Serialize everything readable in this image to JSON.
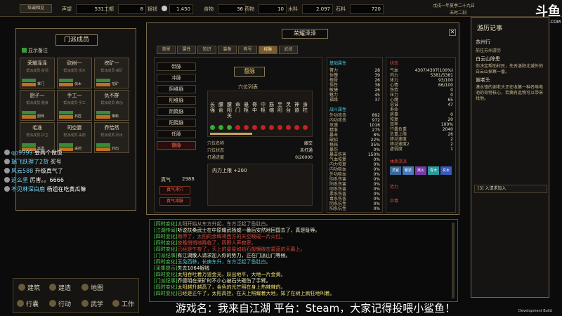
{
  "topbar": {
    "left_btn": "培诚相见",
    "prestige_label": "声望",
    "prestige": "531",
    "work_label": "工都",
    "work": "8",
    "resources": [
      {
        "label": "银钱",
        "value": "1.450"
      },
      {
        "label": "食物",
        "value": "36"
      },
      {
        "label": "药物",
        "value": "10"
      },
      {
        "label": "木料",
        "value": "2.097"
      },
      {
        "label": "石料",
        "value": "720"
      }
    ],
    "date": "戊戌一年夏季二十九日",
    "time": "未时二刻"
  },
  "left": {
    "title": "门派成员",
    "show_notes": "显示备注",
    "members": [
      {
        "name": "荣耀泽泽",
        "sub": "帮派成员·首领",
        "tag": "掌门"
      },
      {
        "name": "砍树一",
        "sub": "帮派成员·伐木",
        "tag": "伐木"
      },
      {
        "name": "挖矿一",
        "sub": "帮派成员·采矿",
        "tag": "挖矿"
      },
      {
        "name": "厨子一",
        "sub": "帮派成员·膳食",
        "tag": "厨师"
      },
      {
        "name": "手工一",
        "sub": "帮派成员·手工",
        "tag": "石匠"
      },
      {
        "name": "仇不群",
        "sub": "帮派成员·练功",
        "tag": "推新"
      },
      {
        "name": "毛准",
        "sub": "帮派成员·护卫",
        "tag": "巡逻"
      },
      {
        "name": "司空霆",
        "sub": "帮派成员·采药",
        "tag": "采药"
      },
      {
        "name": "乔恰然",
        "sub": "帮派成员·外出",
        "tag": "外出"
      }
    ]
  },
  "main": {
    "title": "荣耀泽泽",
    "tabs": [
      "背景",
      "属性",
      "知识",
      "装备",
      "称号",
      "经脉",
      "武技"
    ],
    "active_tab": "经脉",
    "skills": [
      "带脉",
      "冲脉",
      "阴维脉",
      "阳维脉",
      "阴跷脉",
      "阳跷脉",
      "任脉",
      "督脉"
    ],
    "selected_skill": "督脉",
    "panel_title": "督脉",
    "list_title": "穴位列表",
    "acupoints": [
      "长强",
      "腰俞",
      "腰阳关",
      "命门",
      "悬枢",
      "脊中",
      "中枢",
      "筋缩",
      "至阳",
      "灵台",
      "神道",
      "身柱"
    ],
    "acu_info": [
      {
        "label": "穴位名称",
        "value": "龈交"
      },
      {
        "label": "穴位状态",
        "value": "未打通"
      },
      {
        "label": "打通进度",
        "value": "0/20000"
      }
    ],
    "bonus": "内力上限 +200",
    "zhenqi_label": "真气",
    "zhenqi": "2988",
    "btn_flow": "真气冲穴",
    "btn_break": "真气冲脉",
    "basic_title": "基础属性",
    "basic": [
      {
        "label": "膂力",
        "value": "28"
      },
      {
        "label": "体魄",
        "value": "39"
      },
      {
        "label": "根骨",
        "value": "26"
      },
      {
        "label": "悟性",
        "value": "38"
      },
      {
        "label": "敏捷",
        "value": "26"
      },
      {
        "label": "魅力",
        "value": "45"
      },
      {
        "label": "福缘",
        "value": "37"
      }
    ],
    "fight_title": "战斗属性",
    "fight": [
      {
        "label": "外功攻击",
        "value": "892"
      },
      {
        "label": "内功攻击",
        "value": "972"
      },
      {
        "label": "攻速",
        "value": "1016"
      },
      {
        "label": "精准",
        "value": "275"
      },
      {
        "label": "暴击",
        "value": "8%"
      },
      {
        "label": "破招",
        "value": "22%"
      },
      {
        "label": "格挡",
        "value": "35%"
      },
      {
        "label": "暴伤",
        "value": "0%"
      },
      {
        "label": "暴击伤害",
        "value": "150%"
      },
      {
        "label": "气血恢复",
        "value": "0%"
      },
      {
        "label": "内力恢复",
        "value": "0%"
      },
      {
        "label": "内功吸血",
        "value": "0%"
      },
      {
        "label": "外功吸血",
        "value": "0%"
      },
      {
        "label": "阴系伤害",
        "value": "0%"
      },
      {
        "label": "阳系伤害",
        "value": "0%"
      },
      {
        "label": "刚系伤害",
        "value": "0%"
      },
      {
        "label": "柔系伤害",
        "value": "0%"
      },
      {
        "label": "毒系伤害",
        "value": "0%"
      },
      {
        "label": "阴系抗性",
        "value": "0%"
      },
      {
        "label": "阳系抗性",
        "value": "0%"
      }
    ],
    "state_title": "状态",
    "state": [
      {
        "label": "气血",
        "value": "4307/4307(100%)",
        "cls": "green"
      },
      {
        "label": "内力",
        "value": "5381/5381",
        "cls": "cyan"
      },
      {
        "label": "体力",
        "value": "93/100",
        "cls": ""
      },
      {
        "label": "心情",
        "value": "66/100",
        "cls": ""
      },
      {
        "label": "伤势",
        "value": "0",
        "cls": ""
      },
      {
        "label": "压力",
        "value": "0",
        "cls": ""
      },
      {
        "label": "心魔",
        "value": "65",
        "cls": ""
      },
      {
        "label": "忠诚",
        "value": "47",
        "cls": ""
      },
      {
        "label": "寿命",
        "value": "",
        "cls": ""
      },
      {
        "label": "房事",
        "value": "0",
        "cls": ""
      },
      {
        "label": "恢复",
        "value": "20",
        "cls": ""
      },
      {
        "label": "效率",
        "value": "100%",
        "cls": ""
      },
      {
        "label": "行囊负重",
        "value": "2040",
        "cls": ""
      },
      {
        "label": "负重上限",
        "value": "26",
        "cls": ""
      },
      {
        "label": "移动速度",
        "value": "2",
        "cls": ""
      },
      {
        "label": "移动速度2",
        "value": "2",
        "cls": ""
      },
      {
        "label": "虚弱度",
        "value": "1",
        "cls": ""
      }
    ],
    "bloodline_title": "体质流派",
    "bloodline": [
      "灵宫",
      "紫泉",
      "离火",
      "青木",
      "玄水"
    ],
    "faction_title": "势力",
    "faction2_title": "中毒"
  },
  "log": [
    {
      "tag": "[四时变化]",
      "text": "太阳开始从东方升起，东方泛起了鱼肚白。",
      "cls": "green"
    },
    {
      "tag": "[江湖传闻]",
      "text": "听说扶桑武士在中原耀武扬威一番后安然地回国去了，真是耻辱。",
      "cls": "green"
    },
    {
      "tag": "[四时变化]",
      "text": "雨停了，太阳的余晖将西方的天空映成一片火红。",
      "cls": "red"
    },
    {
      "tag": "[四时变化]",
      "text": "夜晚悄悄地降临了，四野人声寂寥。",
      "cls": "red"
    },
    {
      "tag": "[四时变化]",
      "text": "已经是午夜了，天上的星星如钻石般镶嵌在碧蓝的天幕上。",
      "cls": "red"
    },
    {
      "tag": "[门派纪事]",
      "text": "有江湖散人请求加入你的势力，正在门派山门等候。",
      "cls": "green"
    },
    {
      "tag": "[四时变化]",
      "text": "玉兔西移，长庚东升，东方泛起了鱼肚白。",
      "cls": "green"
    },
    {
      "tag": "[采集提示]",
      "text": "失去1064银钱",
      "cls": "green"
    },
    {
      "tag": "[四时变化]",
      "text": "太阳吞吐着万道金光，跃出地平，大地一片金黄。",
      "cls": "green"
    },
    {
      "tag": "[门派纪事]",
      "text": "乔德明在采矿时不小心被石头砸伤了手臂。",
      "cls": "green"
    },
    {
      "tag": "[四时变化]",
      "text": "太阳越升越高了，金色的光芒照在身上热辣辣的。",
      "cls": "green"
    },
    {
      "tag": "[四时变化]",
      "text": "已经是正午了，太阳高挂，在天上照耀着大地，知了在树上疯狂地叫着。",
      "cls": "green"
    }
  ],
  "right": {
    "title": "游历记事",
    "entries": [
      {
        "head": "苏州行",
        "body": "前往苏州游历"
      },
      {
        "head": "白云山除患",
        "body": "你决定帮助村民，先去洛阳北城外的白云山探察一番。"
      },
      {
        "head": "谢老头",
        "body": "漠水镇的谢老头正在收集一种名唤电池的奇特核心，若擒有此物可以带来找他。"
      }
    ],
    "notice": "[3] 入请求加入"
  },
  "menu": {
    "build1": "建筑",
    "build2": "建造",
    "map": "地图",
    "travel": "行囊",
    "action": "行动",
    "martial": "武学",
    "work": "工作"
  },
  "chat": [
    {
      "user": "qp9999",
      "msg": "要两个做饭"
    },
    {
      "user": "瑞飞跃理了2货",
      "msg": "买号"
    },
    {
      "user": "风云588",
      "msg": "升级真气了"
    },
    {
      "user": "这么坚",
      "msg": "厉害。。6666"
    },
    {
      "user": "不见林深白鹿",
      "msg": "杨姐在吃黄瓜嘛"
    }
  ],
  "subtitle": "游戏名：我来自江湖  平台：Steam，大家记得投喂小鲨鱼！",
  "watermark": "斗鱼",
  "watermark_url": "DOUYU.COM",
  "build_label": "Development Build"
}
